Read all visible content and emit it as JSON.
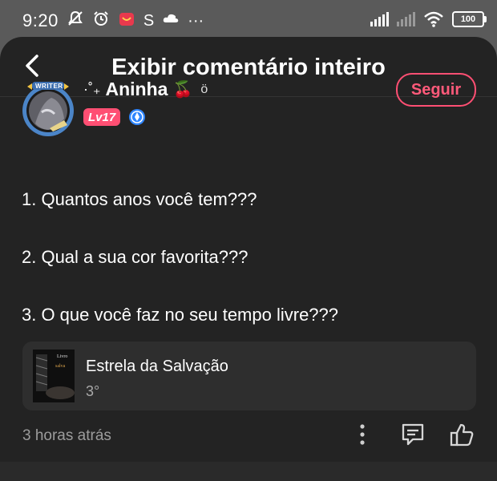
{
  "status_bar": {
    "time": "9:20",
    "icons": [
      "bell-off-icon",
      "alarm-icon",
      "app-badge-icon",
      "s-app-icon",
      "cloud-icon",
      "more-dots-icon"
    ],
    "s_label": "S",
    "more_label": "···",
    "battery": "100"
  },
  "header": {
    "title": "Exibir comentário inteiro",
    "back_icon": "chevron-left-icon"
  },
  "author": {
    "name_prefix": "·˚₊",
    "name": "Aninha",
    "name_emoji": "🍒",
    "name_suffix": "ö",
    "frame_label": "WRITER",
    "level": "Lv17",
    "follow_label": "Seguir",
    "colors": {
      "accent": "#ff4f73",
      "verified": "#2f86ff"
    }
  },
  "comment": {
    "lines": [
      "1. Quantos anos você tem???",
      "2. Qual a sua cor favorita???",
      "3. O que você faz no seu tempo livre???"
    ]
  },
  "story": {
    "title": "Estrela da Salvação",
    "rank": "3°"
  },
  "footer": {
    "timestamp": "3 horas atrás",
    "actions": [
      "more-vertical-icon",
      "comment-icon",
      "like-icon"
    ]
  }
}
